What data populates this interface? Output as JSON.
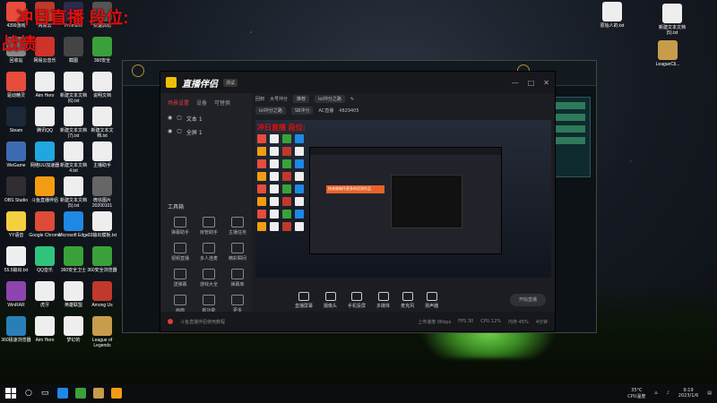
{
  "overlay": {
    "line1": "冲日直播 段位:",
    "line2": "战绩"
  },
  "desktop_icons_left": [
    {
      "label": "4399游戏",
      "color": "#e74c3c"
    },
    {
      "label": "网易云",
      "color": "#c0392b"
    },
    {
      "label": "Premiere",
      "color": "#2c2c4e"
    },
    {
      "label": "快速启动",
      "color": "#555"
    },
    {
      "label": "回收站",
      "color": "#888"
    },
    {
      "label": "网易云音乐",
      "color": "#d0332a"
    },
    {
      "label": "截图",
      "color": "#444"
    },
    {
      "label": "360安全",
      "color": "#3aa13a"
    },
    {
      "label": "驱动精灵",
      "color": "#e74c3c"
    },
    {
      "label": "Aim Hero",
      "color": "#eee"
    },
    {
      "label": "新建文本文档(6).txt",
      "color": "#eee"
    },
    {
      "label": "说明文档",
      "color": "#eee"
    },
    {
      "label": "Steam",
      "color": "#1b2838"
    },
    {
      "label": "腾讯QQ",
      "color": "#eee"
    },
    {
      "label": "新建文本文档(7).txt",
      "color": "#eee"
    },
    {
      "label": "新建文本文档.txt",
      "color": "#eee"
    },
    {
      "label": "WeGame",
      "color": "#3d6bb3"
    },
    {
      "label": "网络UU加速器",
      "color": "#1fa8e0"
    },
    {
      "label": "新建文本文档4.txt",
      "color": "#eee"
    },
    {
      "label": "主播助手",
      "color": "#eee"
    },
    {
      "label": "OBS Studio",
      "color": "#302e31"
    },
    {
      "label": "斗鱼直播伴侣",
      "color": "#f39c12"
    },
    {
      "label": "新建文本文档(5).txt",
      "color": "#eee"
    },
    {
      "label": "微信图片20200101",
      "color": "#666"
    },
    {
      "label": "YY语音",
      "color": "#f4d03f"
    },
    {
      "label": "Google Chrome",
      "color": "#dd4b39"
    },
    {
      "label": "Microsoft Edge",
      "color": "#1e88e5"
    },
    {
      "label": "33输出模板.txt",
      "color": "#eee"
    },
    {
      "label": "55.5输出.txt",
      "color": "#eee"
    },
    {
      "label": "QQ音乐",
      "color": "#31c27c"
    },
    {
      "label": "360安全卫士",
      "color": "#3aa13a"
    },
    {
      "label": "360安全浏览器",
      "color": "#3aa13a"
    },
    {
      "label": "WinRAR",
      "color": "#8e44ad"
    },
    {
      "label": "虎牙",
      "color": "#eee"
    },
    {
      "label": "英雄联盟",
      "color": "#eee"
    },
    {
      "label": "Among Us",
      "color": "#c0392b"
    },
    {
      "label": "360极速浏览器",
      "color": "#2980b9"
    },
    {
      "label": "Aim Hero",
      "color": "#eee"
    },
    {
      "label": "梦幻的",
      "color": "#eee"
    },
    {
      "label": "League of Legends",
      "color": "#c79c4b"
    }
  ],
  "desktop_icons_right": [
    {
      "label": "原始人的.txt",
      "color": "#eee"
    },
    {
      "label": "新建文本文档(5).txt",
      "color": "#eee"
    },
    {
      "label": "LeagueCli...",
      "color": "#c79c4b"
    }
  ],
  "main_window": {
    "title": "直播伴侣",
    "badge": "测试",
    "controls": [
      "—",
      "□",
      "✕"
    ],
    "tabs": [
      "场景设置",
      "设备",
      "可替换"
    ],
    "active_tab": 0,
    "scenes": [
      "文本 1",
      "全屏 1"
    ],
    "tools_title": "工具箱",
    "tools": [
      "弹幕助手",
      "房管助手",
      "主播任务",
      "视频直播",
      "多人连麦",
      "精彩瞬间",
      "送弹幕",
      "游戏大全",
      "弹幕库",
      "画面",
      "新功能",
      "更多"
    ],
    "top_row1": [
      "回到",
      "大号冲分",
      "推荐",
      "lol冲分之路"
    ],
    "top_row2": [
      "lol冲分之路",
      "SB冲分",
      "AC直播",
      "4829405"
    ],
    "preview_text": "冲日直播 段位:",
    "mini_banner": "快来做制作更多的优质作品",
    "bottom_tools": [
      "直播屏幕",
      "摄像头",
      "手机投屏",
      "多媒体",
      "麦克风",
      "扬声器"
    ],
    "go_live": "开始直播",
    "status_items": [
      "斗鱼直播伴侣使用教程",
      "上传速度 0Kbps",
      "FPS 30",
      "CPU 12%",
      "内存 45%",
      "4分钟"
    ]
  },
  "taskbar": {
    "apps": [
      "#1e88e5",
      "#3aa13a",
      "#c79c4b",
      "#f39c12"
    ],
    "weather": "35°C",
    "weather_sub": "CPU温度",
    "time": "9:19",
    "date": "2023/1/6"
  }
}
